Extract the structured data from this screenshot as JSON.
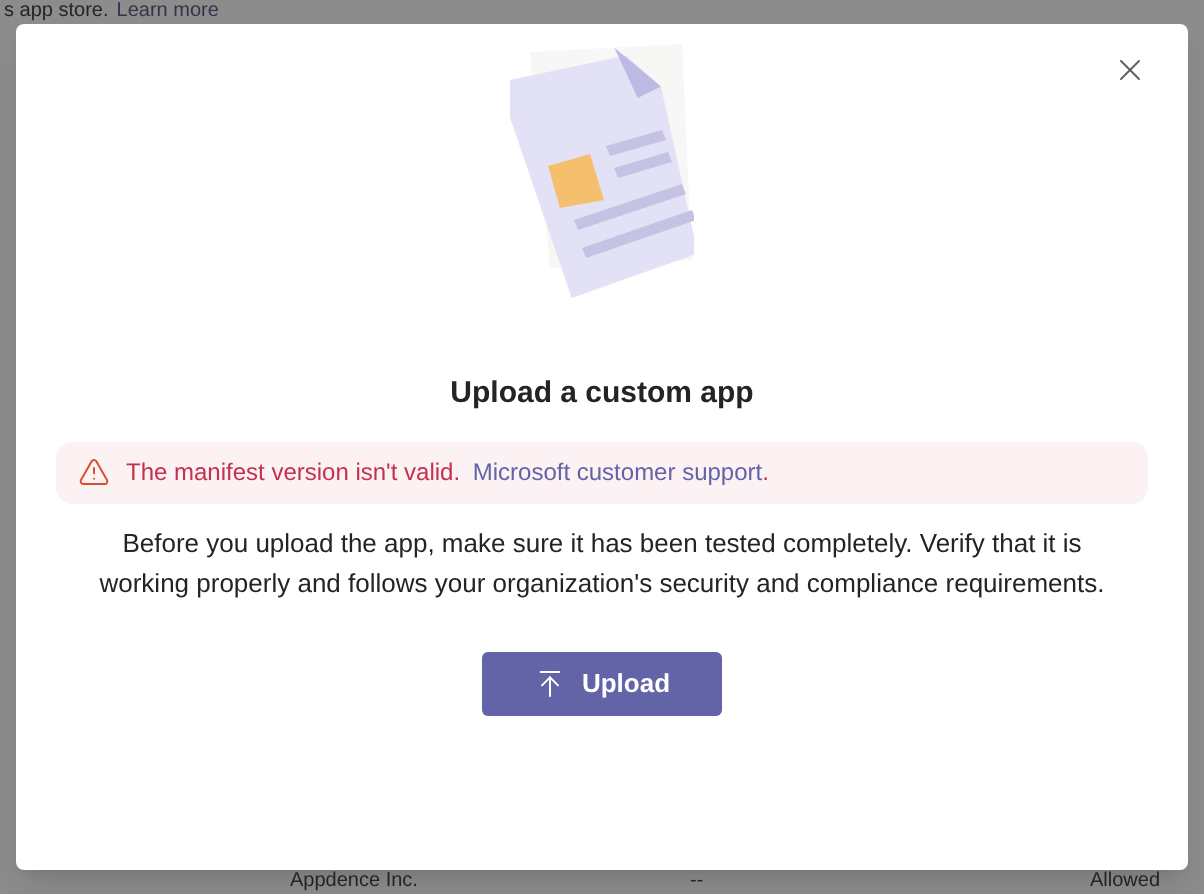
{
  "background": {
    "top_text": "s app store.",
    "top_link": "Learn more",
    "row": [
      "Appdence Inc.",
      "--",
      "Allowed"
    ]
  },
  "dialog": {
    "title": "Upload a custom app",
    "alert": {
      "message": "The manifest version isn't valid.",
      "link": "Microsoft customer support",
      "suffix": "."
    },
    "description": "Before you upload the app, make sure it has been tested completely. Verify that it is working properly and follows your organization's security and compliance requirements.",
    "button": "Upload"
  }
}
